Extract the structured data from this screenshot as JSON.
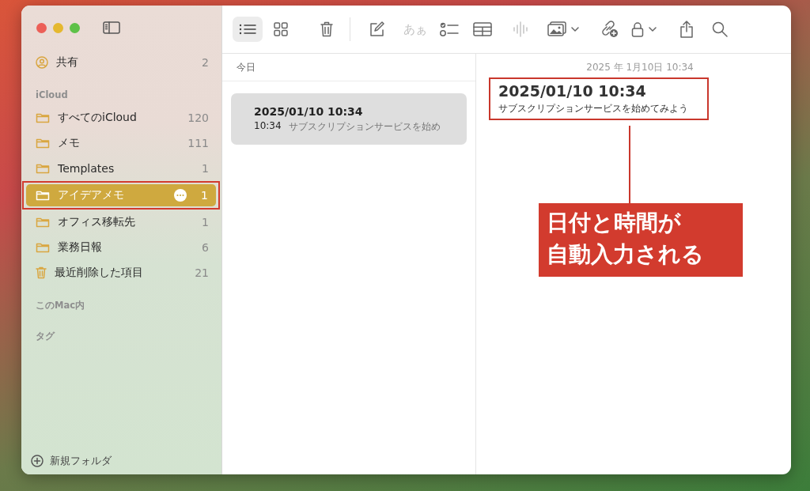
{
  "sidebar": {
    "shared": {
      "label": "共有",
      "count": "2"
    },
    "sections": [
      {
        "title": "iCloud",
        "items": [
          {
            "kind": "folder",
            "label": "すべてのiCloud",
            "count": "120",
            "selected": false,
            "highlighted": false
          },
          {
            "kind": "folder",
            "label": "メモ",
            "count": "111",
            "selected": false,
            "highlighted": false
          },
          {
            "kind": "folder",
            "label": "Templates",
            "count": "1",
            "selected": false,
            "highlighted": false
          },
          {
            "kind": "folder",
            "label": "アイデアメモ",
            "count": "1",
            "selected": true,
            "highlighted": true
          },
          {
            "kind": "folder",
            "label": "オフィス移転先",
            "count": "1",
            "selected": false,
            "highlighted": false
          },
          {
            "kind": "folder",
            "label": "業務日報",
            "count": "6",
            "selected": false,
            "highlighted": false
          },
          {
            "kind": "trash",
            "label": "最近削除した項目",
            "count": "21",
            "selected": false,
            "highlighted": false
          }
        ]
      },
      {
        "title": "このMac内"
      },
      {
        "title": "タグ"
      }
    ],
    "new_folder": "新規フォルダ"
  },
  "toolbar": [
    {
      "kind": "list",
      "selected": true,
      "disabled": false
    },
    {
      "kind": "grid",
      "selected": false,
      "disabled": false
    },
    {
      "kind": "trash",
      "disabled": false
    },
    {
      "kind": "divider"
    },
    {
      "kind": "compose",
      "disabled": false
    },
    {
      "kind": "format",
      "label": "あぁ",
      "disabled": true
    },
    {
      "kind": "checklist",
      "disabled": false
    },
    {
      "kind": "table",
      "disabled": false
    },
    {
      "kind": "audio",
      "disabled": true
    },
    {
      "kind": "media",
      "disabled": false
    },
    {
      "kind": "collaborate",
      "disabled": false
    },
    {
      "kind": "lock",
      "disabled": false
    },
    {
      "kind": "share",
      "disabled": false
    },
    {
      "kind": "search",
      "disabled": false
    }
  ],
  "note_list": {
    "group": "今日",
    "notes": [
      {
        "title": "2025/01/10 10:34",
        "time": "10:34",
        "preview": "サブスクリプションサービスを始め",
        "selected": true
      }
    ]
  },
  "editor": {
    "date": "2025 年 1月10日 10:34",
    "title": "2025/01/10 10:34",
    "body": "サブスクリプションサービスを始めてみよう",
    "highlighted": true
  },
  "annotation": {
    "lines": [
      "日付と時間が",
      "自動入力される"
    ]
  }
}
